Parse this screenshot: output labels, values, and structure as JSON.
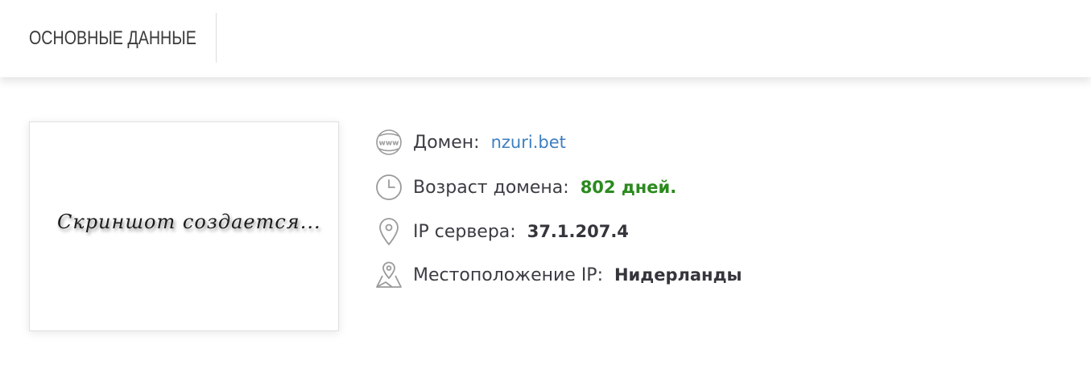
{
  "header": {
    "tab_label": "ОСНОВНЫЕ ДАННЫЕ"
  },
  "screenshot": {
    "placeholder_text": "Скриншот создается..."
  },
  "info": {
    "domain": {
      "label": "Домен:",
      "value": "nzuri.bet",
      "icon": "www-globe-icon"
    },
    "age": {
      "label": "Возраст домена:",
      "value": "802 дней.",
      "icon": "clock-icon"
    },
    "ip": {
      "label": "IP сервера:",
      "value": "37.1.207.4",
      "icon": "location-pin-icon"
    },
    "location": {
      "label": "Местоположение IP:",
      "value": "Нидерланды",
      "icon": "map-pin-icon"
    }
  },
  "colors": {
    "link": "#3d7fc1",
    "age_value": "#2b8a1e",
    "text": "#3c3c44",
    "icon": "#9a9a9a"
  }
}
